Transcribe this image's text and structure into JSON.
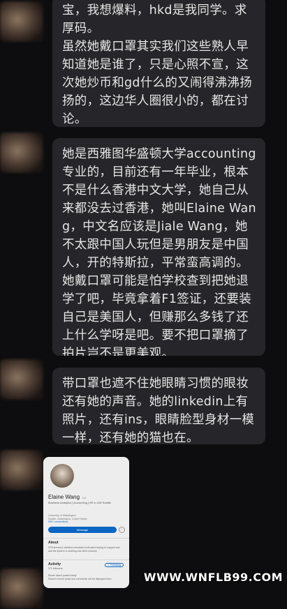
{
  "messages": [
    {
      "text": "宝，我想爆料，hkd是我同学。求厚码。\n虽然她戴口罩其实我们这些熟人早知道她是谁了，只是心照不宣，这次她炒币和gd什么的又闹得沸沸扬扬的，这边华人圈很小的，都在讨论。"
    },
    {
      "text": "她是西雅图华盛顿大学accounting专业的，目前还有一年毕业，根本不是什么香港中文大学，她自己从来都没去过香港，她叫Elaine Wang，中文名应该是Jiale Wang，她不太跟中国人玩但是男朋友是中国人，开的特斯拉，平常蛮高调的。她戴口罩可能是怕学校查到把她退学了吧，毕竟拿着F1签证，还要装自己是美国人，但赚那么多钱了还上什么学呀是吧。要不把口罩摘了拍片岂不是更美观。"
    },
    {
      "text": "带口罩也遮不住她眼睛习惯的眼妆还有她的声音。她的linkedin上有照片，还有ins，眼睛脸型身材一模一样，还有她的猫也在。"
    }
  ],
  "linkedin": {
    "name": "Elaine Wang",
    "pronoun": "·1st",
    "headline": "Business Analytics | Accounting | BS in UW Seattle",
    "location": "University of Washington\nSeattle, Washington, United States",
    "connections": "500+ connections",
    "message_button": "Message",
    "more_button": "···",
    "about_title": "About",
    "about_text": "CPA licensed, detailed-orientated motivated hoping to support and add the system in auditing and other industry.",
    "activity_title": "Activity",
    "activity_followers": "372 followers",
    "following_button": "✓ Following",
    "activity_text": "Elaine hasn't posted lately\nElaine's recent posts and comments will be displayed here."
  },
  "watermark": "WWW.WNFLB99.COM"
}
